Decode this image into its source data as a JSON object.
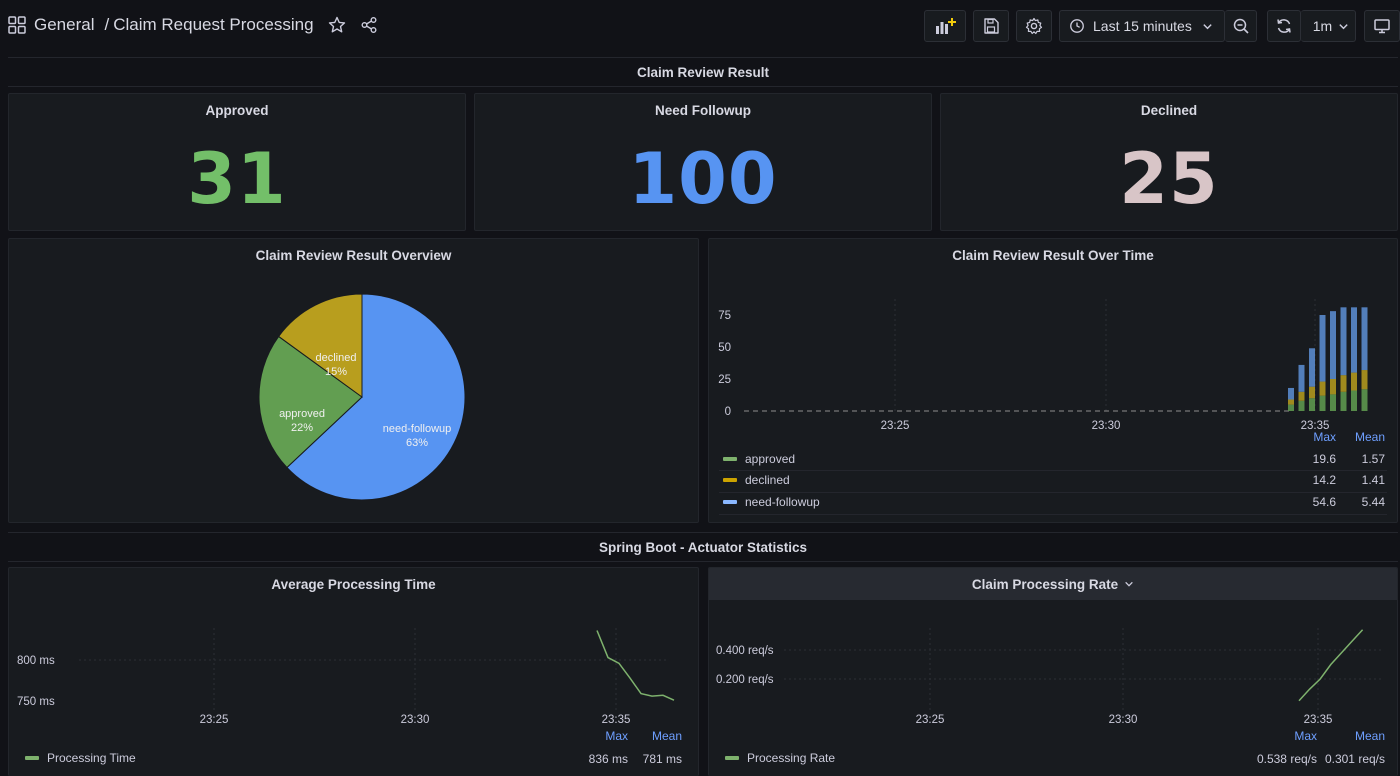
{
  "header": {
    "breadcrumb_folder": "General",
    "breadcrumb_separator": "/",
    "dashboard_title": "Claim Request Processing",
    "time_range": "Last 15 minutes",
    "refresh_interval": "1m"
  },
  "rows": {
    "review_result": "Claim Review Result",
    "actuator": "Spring Boot - Actuator Statistics"
  },
  "stats": [
    {
      "title": "Approved",
      "value": "31",
      "color": "#73bf69"
    },
    {
      "title": "Need Followup",
      "value": "100",
      "color": "#5794f2"
    },
    {
      "title": "Declined",
      "value": "25",
      "color": "#d8c5c7"
    }
  ],
  "pie_panel": {
    "title": "Claim Review Result Overview",
    "chart_data": {
      "type": "pie",
      "slices": [
        {
          "label": "need-followup",
          "percent": "63%",
          "value": 63,
          "color": "#5794f2"
        },
        {
          "label": "approved",
          "percent": "22%",
          "value": 22,
          "color": "#629e51"
        },
        {
          "label": "declined",
          "percent": "15%",
          "value": 15,
          "color": "#b89e1e"
        }
      ]
    }
  },
  "time_panel": {
    "title": "Claim Review Result Over Time",
    "legend_headers": {
      "max": "Max",
      "mean": "Mean"
    },
    "legend": [
      {
        "name": "approved",
        "max": "19.6",
        "mean": "1.57",
        "color": "#7eb26d"
      },
      {
        "name": "declined",
        "max": "14.2",
        "mean": "1.41",
        "color": "#cca300"
      },
      {
        "name": "need-followup",
        "max": "54.6",
        "mean": "5.44",
        "color": "#8ab8ff"
      }
    ],
    "chart_data": {
      "type": "bar",
      "stacked": true,
      "x_ticks": [
        "23:25",
        "23:30",
        "23:35"
      ],
      "y_ticks": [
        "0",
        "25",
        "50",
        "75"
      ],
      "ylim": [
        0,
        80
      ],
      "bars": [
        {
          "approved": 5,
          "declined": 4,
          "need_followup": 9
        },
        {
          "approved": 8,
          "declined": 7,
          "need_followup": 21
        },
        {
          "approved": 10,
          "declined": 9,
          "need_followup": 30
        },
        {
          "approved": 12,
          "declined": 11,
          "need_followup": 52
        },
        {
          "approved": 13,
          "declined": 12,
          "need_followup": 53
        },
        {
          "approved": 15,
          "declined": 13,
          "need_followup": 53
        },
        {
          "approved": 16,
          "declined": 14,
          "need_followup": 51
        },
        {
          "approved": 17,
          "declined": 15,
          "need_followup": 49
        }
      ]
    }
  },
  "avg_panel": {
    "title": "Average Processing Time",
    "legend_headers": {
      "max": "Max",
      "mean": "Mean"
    },
    "legend": [
      {
        "name": "Processing Time",
        "max": "836 ms",
        "mean": "781 ms",
        "color": "#7eb26d"
      }
    ],
    "chart_data": {
      "type": "line",
      "x_ticks": [
        "23:25",
        "23:30",
        "23:35"
      ],
      "y_ticks": [
        "750 ms",
        "800 ms"
      ],
      "points": [
        [
          0,
          836
        ],
        [
          1,
          803
        ],
        [
          2,
          796
        ],
        [
          3,
          778
        ],
        [
          4,
          759
        ],
        [
          5,
          756
        ],
        [
          6,
          757
        ],
        [
          7,
          751
        ]
      ]
    }
  },
  "rate_panel": {
    "title": "Claim Processing Rate",
    "legend_headers": {
      "max": "Max",
      "mean": "Mean"
    },
    "legend": [
      {
        "name": "Processing Rate",
        "max": "0.538 req/s",
        "mean": "0.301 req/s",
        "color": "#7eb26d"
      }
    ],
    "chart_data": {
      "type": "line",
      "x_ticks": [
        "23:25",
        "23:30",
        "23:35"
      ],
      "y_ticks": [
        "0.200 req/s",
        "0.400 req/s"
      ],
      "points": [
        [
          0,
          0.05
        ],
        [
          1,
          0.13
        ],
        [
          2,
          0.2
        ],
        [
          3,
          0.3
        ],
        [
          4,
          0.38
        ],
        [
          5,
          0.46
        ],
        [
          6,
          0.54
        ]
      ]
    }
  }
}
